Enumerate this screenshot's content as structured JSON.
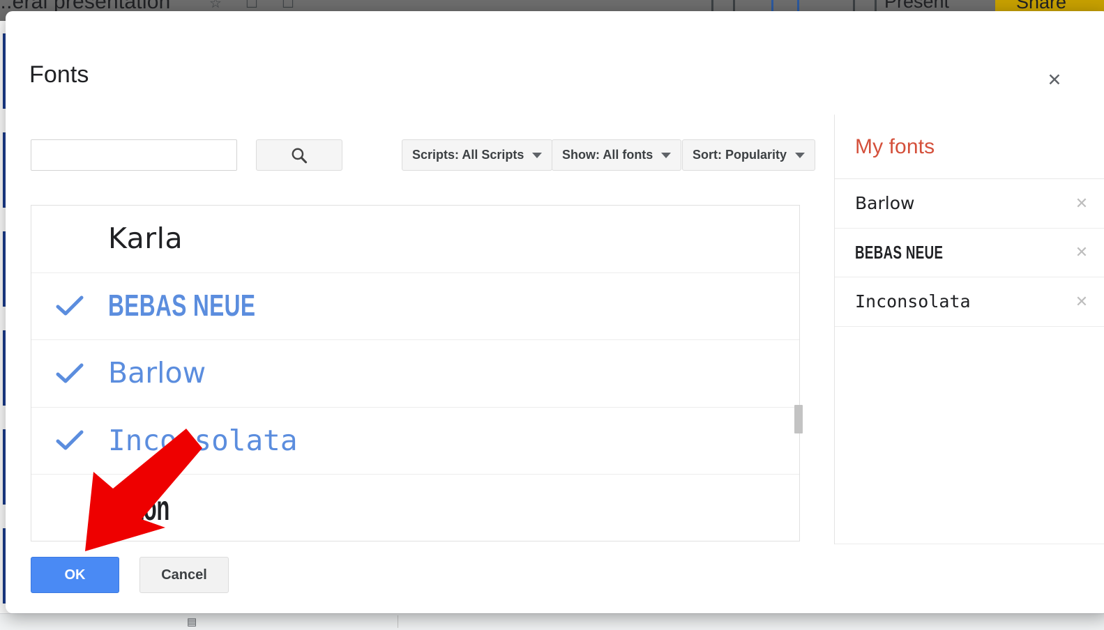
{
  "background_app": {
    "title": "...eral presentation",
    "present_label": "Present",
    "share_label": "Share",
    "icons": [
      "star-icon",
      "move-to-folder-icon",
      "cloud-status-icon",
      "minus-box-icon",
      "blue-box-icon",
      "present-screen-icon",
      "person-add-icon"
    ]
  },
  "dialog": {
    "title": "Fonts",
    "close_label": "✕",
    "search": {
      "value": "",
      "placeholder": "",
      "button_icon": "search-icon"
    },
    "filters": [
      {
        "id": "scripts",
        "label": "Scripts: All Scripts",
        "selected": "All Scripts"
      },
      {
        "id": "show",
        "label": "Show: All fonts",
        "selected": "All fonts"
      },
      {
        "id": "sort",
        "label": "Sort: Popularity",
        "selected": "Popularity"
      }
    ],
    "font_list": [
      {
        "name": "Karla",
        "selected": false,
        "style": "fn-karla"
      },
      {
        "name": "BEBAS NEUE",
        "selected": true,
        "style": "fn-bebas"
      },
      {
        "name": "Barlow",
        "selected": true,
        "style": "fn-barlow"
      },
      {
        "name": "Inconsolata",
        "selected": true,
        "style": "fn-inconsolata"
      },
      {
        "name": "Anton",
        "selected": false,
        "style": "fn-anton"
      }
    ],
    "my_fonts": {
      "title": "My fonts",
      "remove_label": "✕",
      "items": [
        {
          "name": "Barlow",
          "style": "fn-barlow"
        },
        {
          "name": "BEBAS NEUE",
          "style": "fn-bebas"
        },
        {
          "name": "Inconsolata",
          "style": "fn-inconsolata"
        }
      ]
    },
    "footer": {
      "ok_label": "OK",
      "cancel_label": "Cancel"
    },
    "colors": {
      "accent_blue": "#4a8af4",
      "selected_font_blue": "#5b8dde",
      "my_fonts_red": "#d4503b",
      "annotation_red": "#ee0000"
    }
  }
}
